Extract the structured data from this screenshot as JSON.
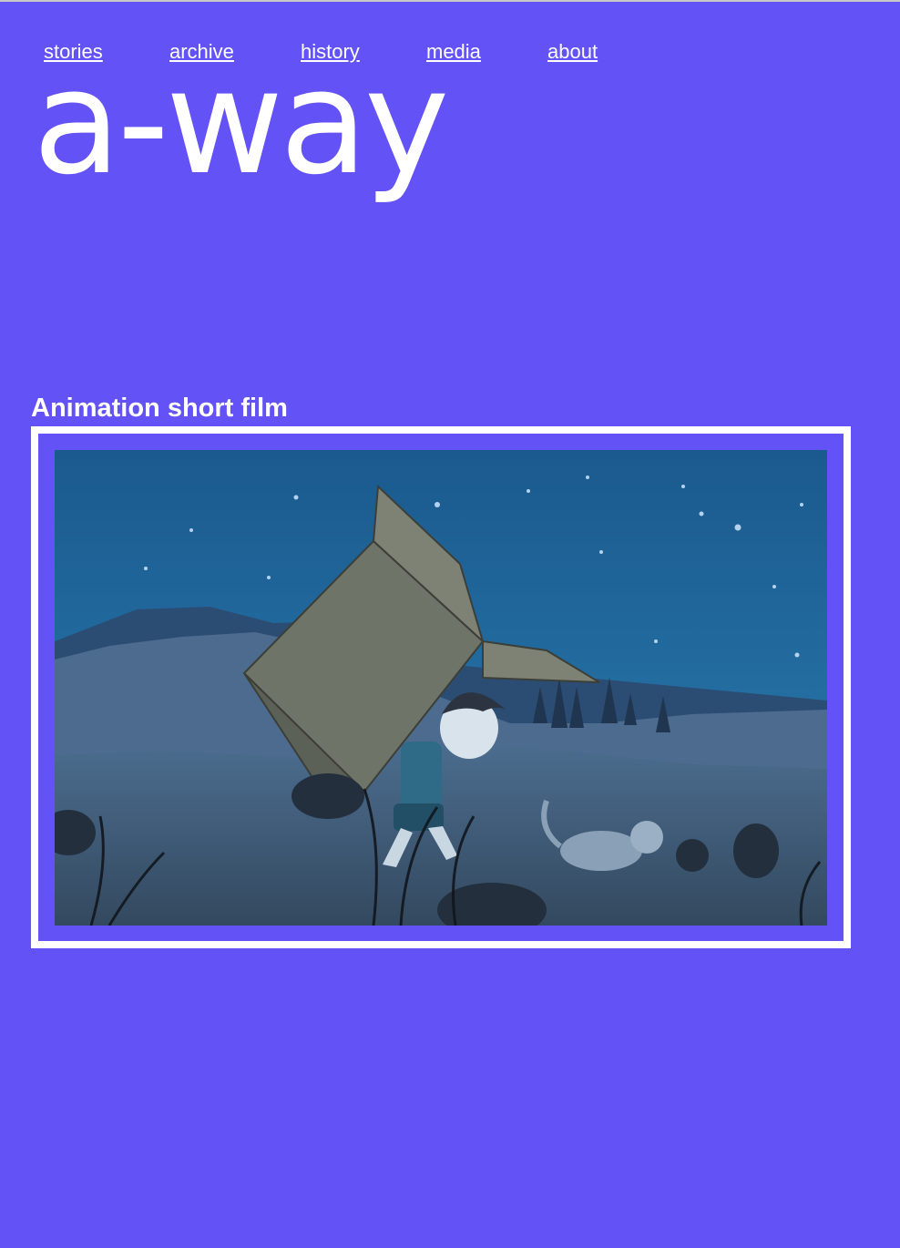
{
  "nav": {
    "items": [
      {
        "label": "stories"
      },
      {
        "label": "archive"
      },
      {
        "label": "history"
      },
      {
        "label": "media"
      },
      {
        "label": "about"
      }
    ]
  },
  "site": {
    "logo": "a-way"
  },
  "main": {
    "section_title": "Animation short film",
    "video": {
      "description_icon": "animation-still-image"
    }
  },
  "colors": {
    "background": "#6352f5",
    "text": "#ffffff",
    "frame": "#ffffff",
    "sky": "#1d5f95"
  }
}
